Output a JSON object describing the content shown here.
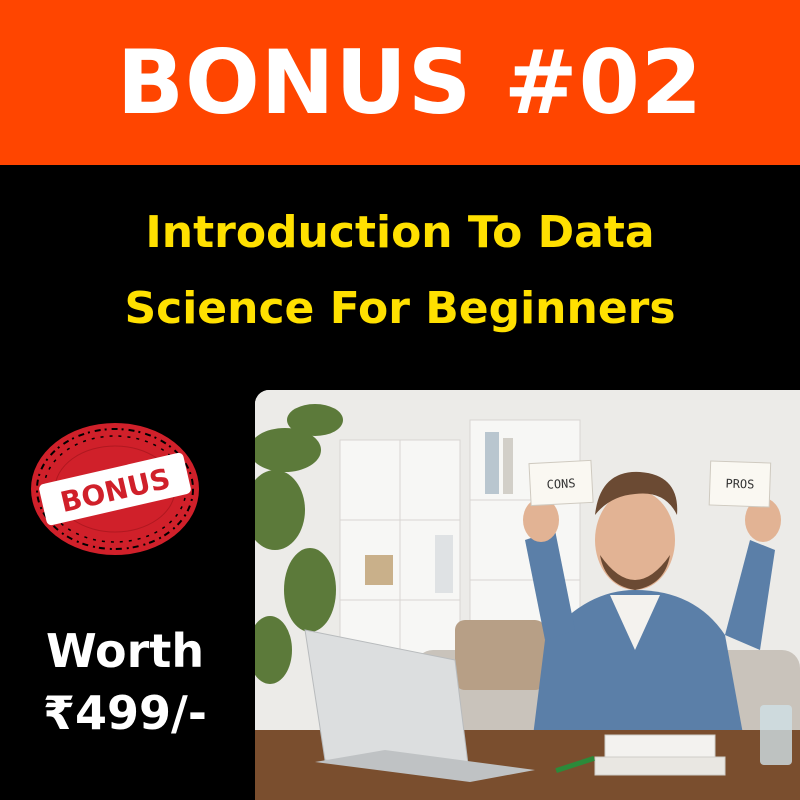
{
  "banner": {
    "title": "BONUS #02"
  },
  "headline": {
    "line1": "Introduction To Data",
    "line2": "Science For Beginners"
  },
  "stamp": {
    "label": "BONUS"
  },
  "price": {
    "line1": "Worth",
    "line2": "₹499/-"
  },
  "photo": {
    "card_left": "CONS",
    "card_right": "PROS"
  },
  "colors": {
    "banner_bg": "#ff4500",
    "headline": "#ffe000",
    "stamp": "#d0202a",
    "background": "#000000"
  }
}
